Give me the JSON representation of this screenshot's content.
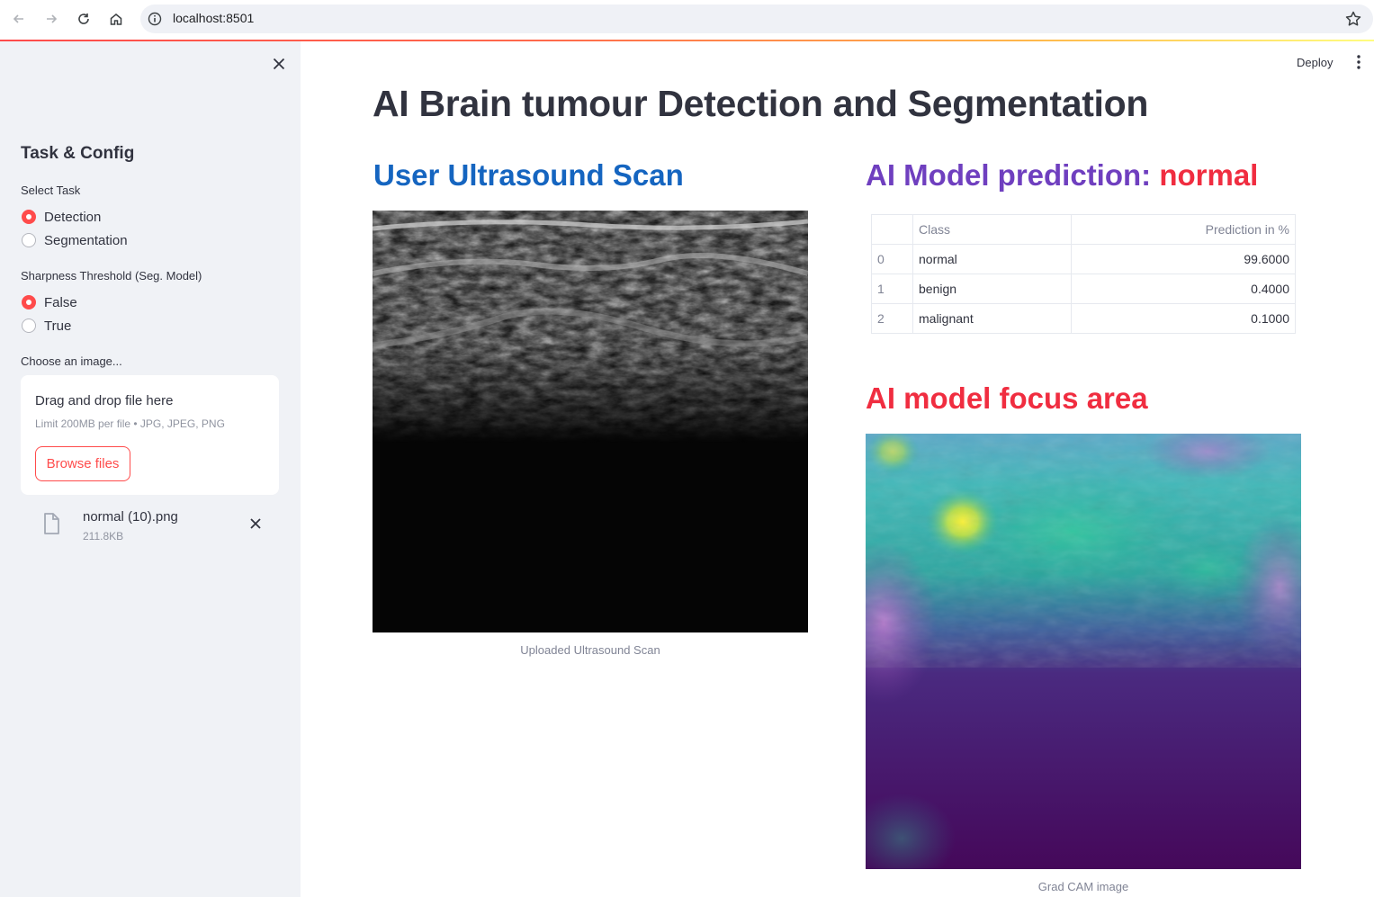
{
  "browser": {
    "url": "localhost:8501"
  },
  "sidebar": {
    "heading": "Task & Config",
    "select_task": {
      "label": "Select Task",
      "options": [
        "Detection",
        "Segmentation"
      ],
      "selected": "Detection"
    },
    "sharpness": {
      "label": "Sharpness Threshold (Seg. Model)",
      "options": [
        "False",
        "True"
      ],
      "selected": "False"
    },
    "uploader": {
      "label": "Choose an image...",
      "drag_text": "Drag and drop file here",
      "limit_text": "Limit 200MB per file • JPG, JPEG, PNG",
      "browse_label": "Browse files"
    },
    "file": {
      "name": "normal (10).png",
      "size": "211.8KB"
    }
  },
  "header": {
    "deploy_label": "Deploy"
  },
  "main": {
    "title": "AI Brain tumour Detection and Segmentation",
    "scan_heading": "User Ultrasound Scan",
    "scan_caption": "Uploaded Ultrasound Scan",
    "prediction_heading_prefix": "AI Model prediction: ",
    "prediction_result": "normal",
    "focus_heading": "AI model focus area",
    "gradcam_caption": "Grad CAM image",
    "table": {
      "columns": [
        "",
        "Class",
        "Prediction in %"
      ],
      "rows": [
        {
          "index": "0",
          "class": "normal",
          "value": "99.6000"
        },
        {
          "index": "1",
          "class": "benign",
          "value": "0.4000"
        },
        {
          "index": "2",
          "class": "malignant",
          "value": "0.1000"
        }
      ]
    }
  },
  "colors": {
    "accent": "#ff4b4b",
    "scan_heading": "#1565c0",
    "prediction_heading": "#6f3fbf",
    "result_red": "#f02d40",
    "sidebar_bg": "#f0f2f6"
  }
}
